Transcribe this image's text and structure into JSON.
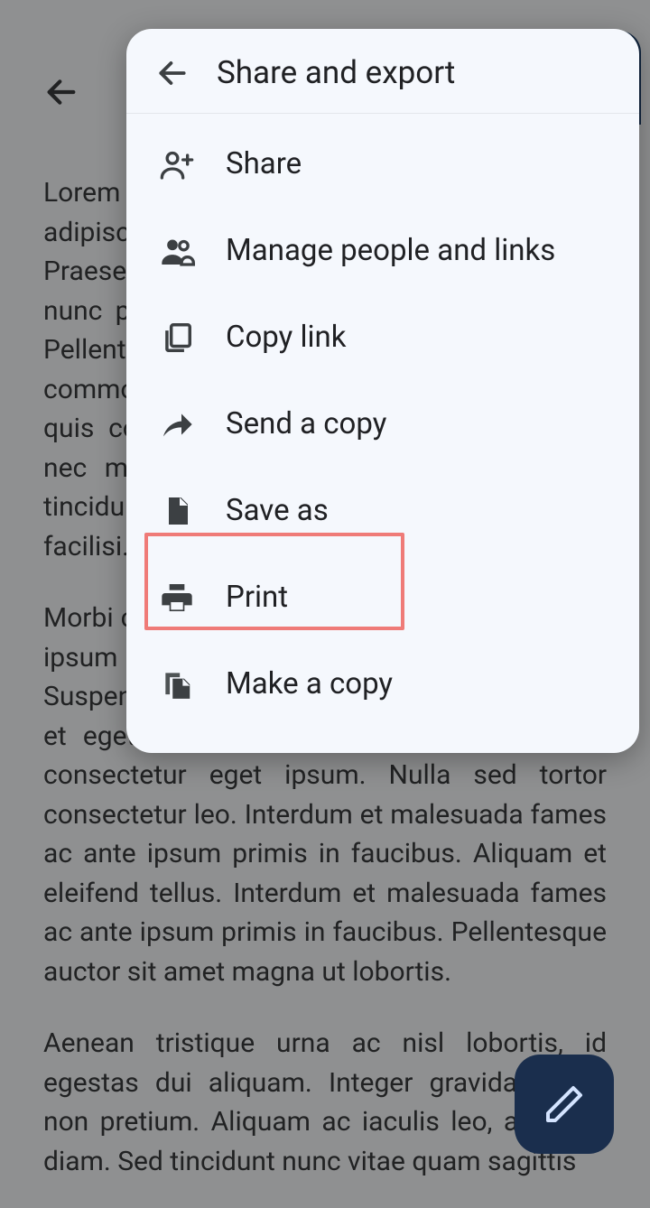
{
  "document": {
    "paragraph1": "Lorem ipsum dolor sit amet, consectetur adipiscing elit. Maecenas consectetur justo. Praesent euismod tristique mi, ac vehicula nunc porta sed. Nullam sit amet lectus nisl. Pellentesque eleifend magna sed nisi commodo tristique. Sed nunc, consectetur quis consectetur ut, vehicula vitae lacus. Ut nec mollis mi. Vivamus eget mi a magna tincidunt pretium dui. Nulla facilisi. Nulla facilisi. Nulla facilisis.",
    "paragraph2": "Morbi cursus rutrum magna. Suspendisse quis ipsum massa. Ut et tincidunt sem. Suspendisse eget dui eu nibh laoreet tincidunt et eget tellus. Duis eu nisl at leo vehicula consectetur eget ipsum. Nulla sed tortor consectetur leo. Interdum et malesuada fames ac ante ipsum primis in faucibus. Aliquam et eleifend tellus. Interdum et malesuada fames ac ante ipsum primis in faucibus. Pellentesque auctor sit amet magna ut lobortis.",
    "paragraph3": "Aenean tristique urna ac nisl lobortis, id egestas dui aliquam. Integer gravida lectus non pretium. Aliquam ac iaculis leo, a auctor diam. Sed tincidunt nunc vitae quam sagittis"
  },
  "sheet": {
    "title": "Share and export",
    "items": [
      {
        "label": "Share"
      },
      {
        "label": "Manage people and links"
      },
      {
        "label": "Copy link"
      },
      {
        "label": "Send a copy"
      },
      {
        "label": "Save as"
      },
      {
        "label": "Print"
      },
      {
        "label": "Make a copy"
      }
    ]
  }
}
